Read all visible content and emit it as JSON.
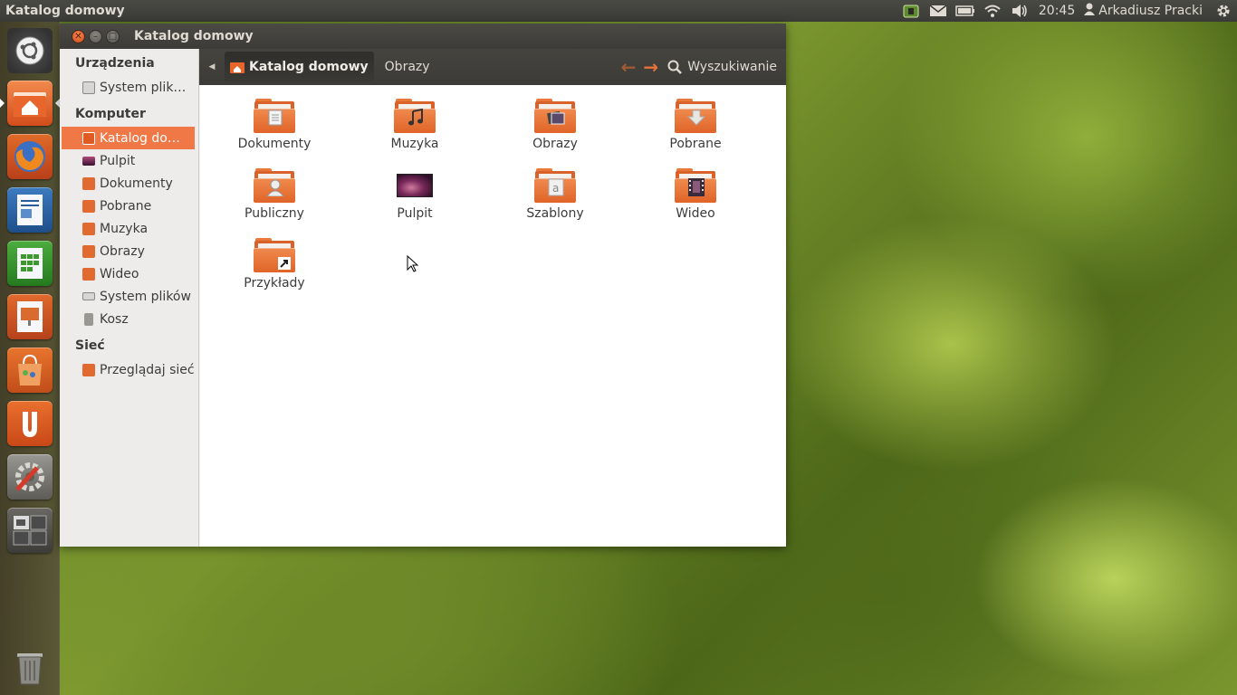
{
  "top_panel": {
    "title": "Katalog domowy",
    "clock": "20:45",
    "user": "Arkadiusz Pracki",
    "tray_icons": [
      "network-manager-icon",
      "mail-icon",
      "battery-icon",
      "wifi-icon",
      "volume-icon"
    ]
  },
  "launcher": {
    "items": [
      "dash-home-icon",
      "home-folder-icon",
      "firefox-icon",
      "libreoffice-writer-icon",
      "libreoffice-calc-icon",
      "libreoffice-impress-icon",
      "software-center-icon",
      "ubuntu-one-icon",
      "system-settings-icon",
      "workspace-switcher-icon"
    ],
    "trash": "trash-icon"
  },
  "window": {
    "title": "Katalog domowy",
    "breadcrumb": {
      "active": "Katalog domowy",
      "next": "Obrazy"
    },
    "search_label": "Wyszukiwanie"
  },
  "sidebar": {
    "devices_heading": "Urządzenia",
    "devices": [
      {
        "label": "System plik…"
      }
    ],
    "computer_heading": "Komputer",
    "computer": [
      {
        "label": "Katalog do…",
        "active": true
      },
      {
        "label": "Pulpit"
      },
      {
        "label": "Dokumenty"
      },
      {
        "label": "Pobrane"
      },
      {
        "label": "Muzyka"
      },
      {
        "label": "Obrazy"
      },
      {
        "label": "Wideo"
      },
      {
        "label": "System plików"
      },
      {
        "label": "Kosz"
      }
    ],
    "network_heading": "Sieć",
    "network": [
      {
        "label": "Przeglądaj sieć"
      }
    ]
  },
  "files": [
    {
      "label": "Dokumenty",
      "emblem": "document"
    },
    {
      "label": "Muzyka",
      "emblem": "music"
    },
    {
      "label": "Obrazy",
      "emblem": "pictures"
    },
    {
      "label": "Pobrane",
      "emblem": "download"
    },
    {
      "label": "Publiczny",
      "emblem": "user"
    },
    {
      "label": "Pulpit",
      "emblem": "desktop"
    },
    {
      "label": "Szablony",
      "emblem": "template"
    },
    {
      "label": "Wideo",
      "emblem": "video"
    },
    {
      "label": "Przykłady",
      "emblem": "link"
    }
  ],
  "colors": {
    "accent": "#f07746",
    "panel": "#3c3b37",
    "folder_orange": "#e06428"
  }
}
